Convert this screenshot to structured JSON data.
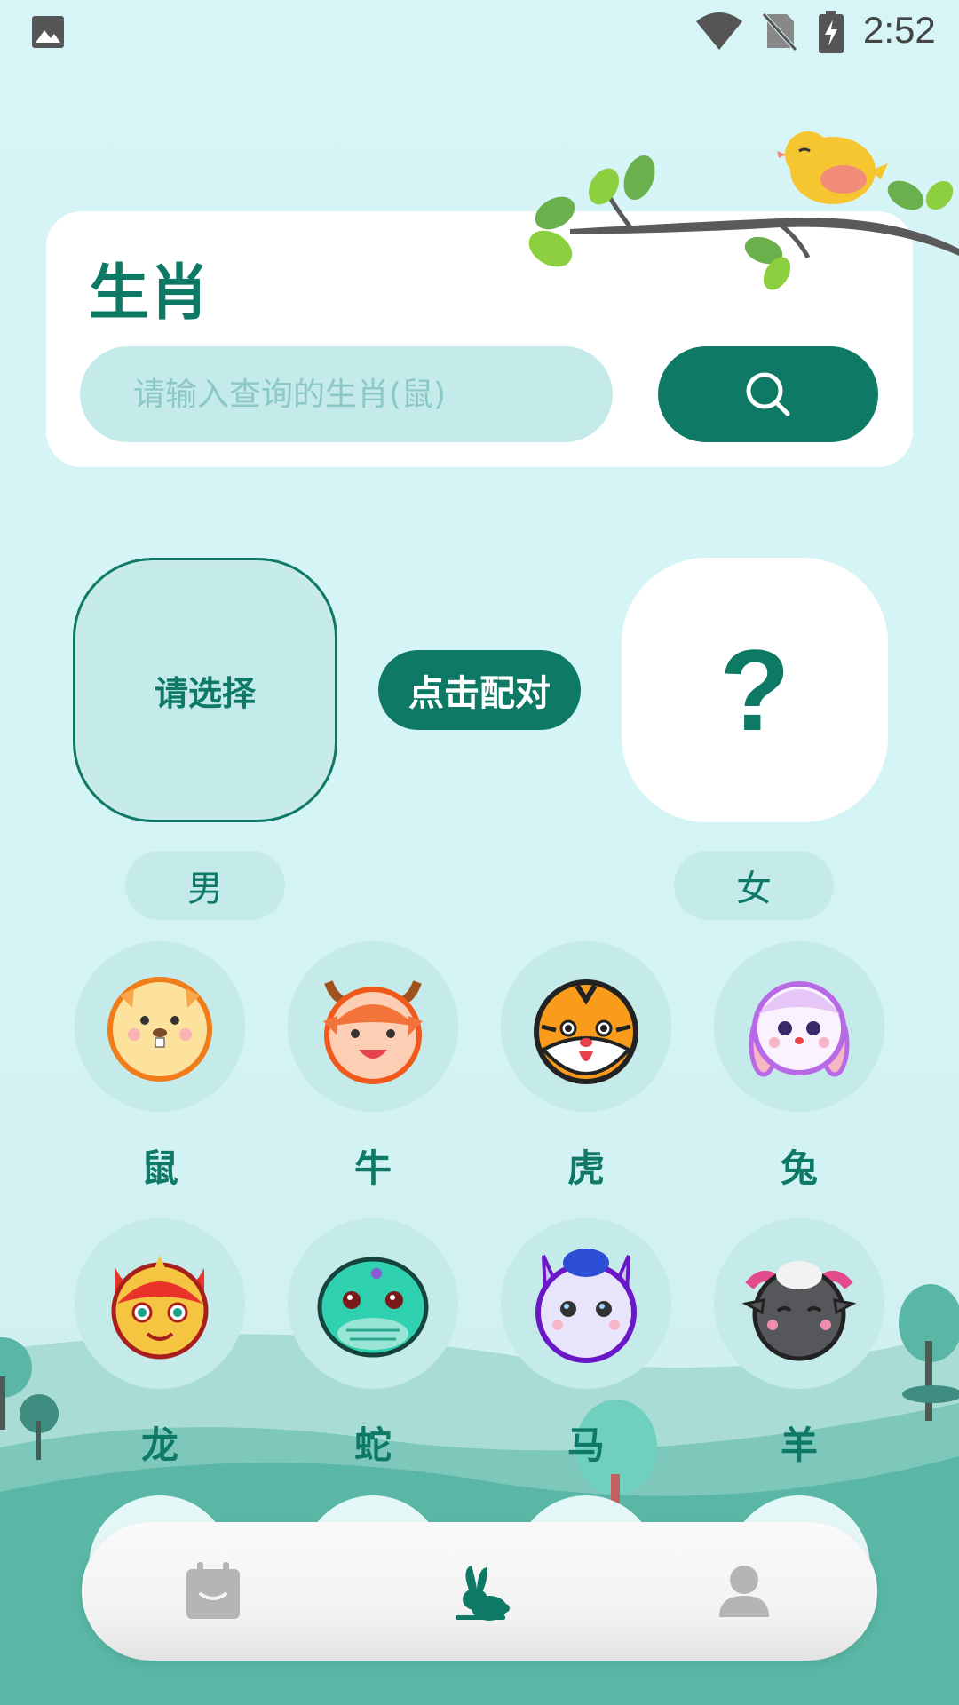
{
  "status_bar": {
    "time": "2:52"
  },
  "header": {
    "title": "生肖",
    "search_placeholder": "请输入查询的生肖(鼠)"
  },
  "pairing": {
    "select_label": "请选择",
    "match_button": "点击配对",
    "result_placeholder": "?",
    "male_label": "男",
    "female_label": "女"
  },
  "zodiac": [
    {
      "name": "鼠"
    },
    {
      "name": "牛"
    },
    {
      "name": "虎"
    },
    {
      "name": "兔"
    },
    {
      "name": "龙"
    },
    {
      "name": "蛇"
    },
    {
      "name": "马"
    },
    {
      "name": "羊"
    }
  ],
  "bottom_nav": {
    "items": [
      "calendar-icon",
      "rabbit-icon",
      "user-icon"
    ],
    "active_index": 1
  },
  "colors": {
    "primary": "#0e7a66",
    "background": "#d6f4f6",
    "circle": "#c4eaea",
    "inactive_icon": "#b5b5b5"
  }
}
